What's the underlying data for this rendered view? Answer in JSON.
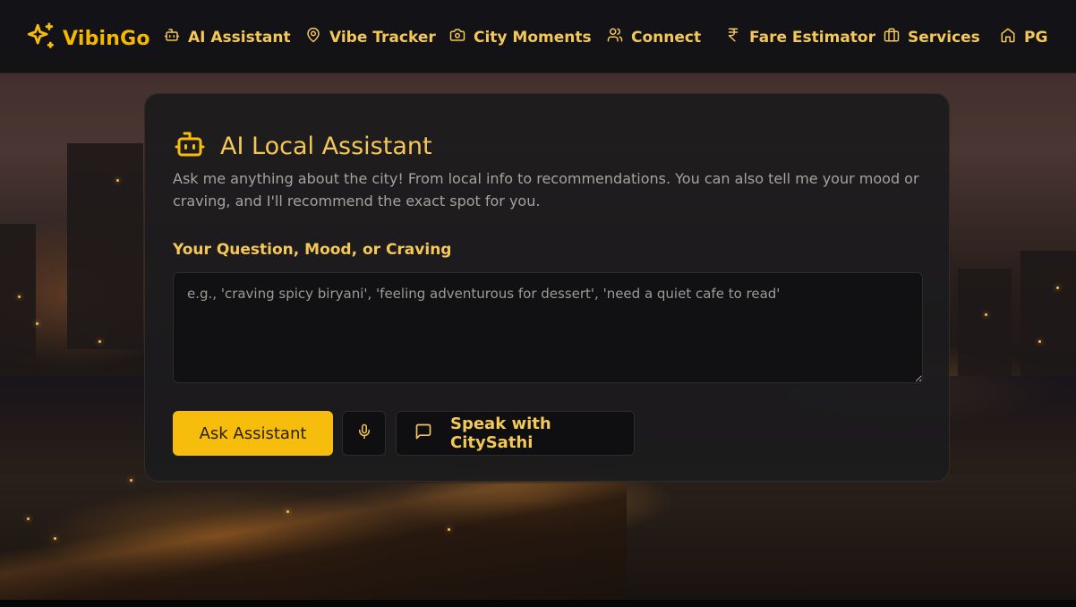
{
  "theme": {
    "accent": "#f6bd0c",
    "accent_text": "#f3c857",
    "card_bg": "#1c1b1d",
    "nav_bg": "#121216"
  },
  "brand": {
    "name": "VibinGo",
    "icon": "sparkles-icon"
  },
  "nav": {
    "items": [
      {
        "label": "AI Assistant",
        "icon": "bot-icon"
      },
      {
        "label": "Vibe Tracker",
        "icon": "map-pin-icon"
      },
      {
        "label": "City Moments",
        "icon": "camera-icon"
      },
      {
        "label": "Connect",
        "icon": "users-icon"
      },
      {
        "label": "Fare Estimator",
        "icon": "rupee-icon"
      },
      {
        "label": "Services",
        "icon": "briefcase-icon"
      },
      {
        "label": "PG",
        "icon": "home-icon"
      }
    ]
  },
  "assistant": {
    "title": "AI Local Assistant",
    "icon": "bot-icon",
    "description": "Ask me anything about the city! From local info to recommendations. You can also tell me your mood or craving, and I'll recommend the exact spot for you.",
    "field_label": "Your Question, Mood, or Craving",
    "input_value": "",
    "input_placeholder": "e.g., 'craving spicy biryani', 'feeling adventurous for dessert', 'need a quiet cafe to read'",
    "ask_label": "Ask Assistant",
    "mic_icon": "microphone-icon",
    "speak_label": "Speak with CitySathi",
    "speak_icon": "message-square-icon"
  }
}
